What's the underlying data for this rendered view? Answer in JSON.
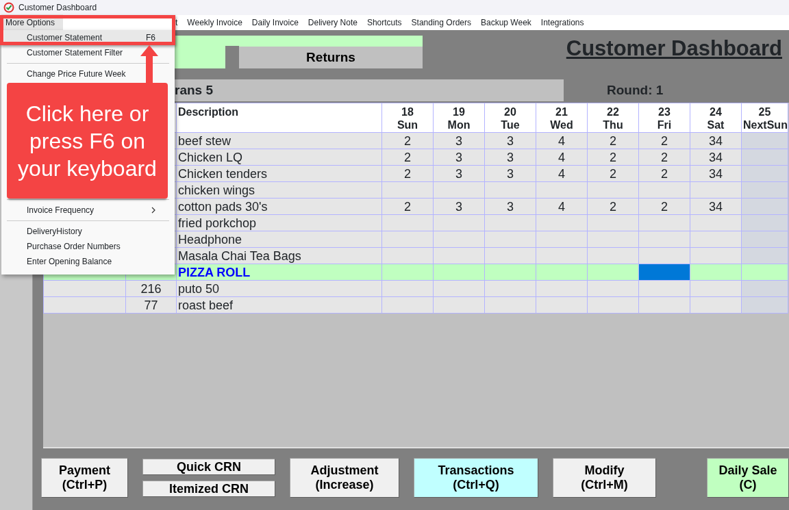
{
  "window": {
    "title": "Customer Dashboard"
  },
  "menu_bar": [
    {
      "label": "t",
      "selected": false
    },
    {
      "label": "Weekly Invoice",
      "selected": false
    },
    {
      "label": "Daily Invoice",
      "selected": false
    },
    {
      "label": "Delivery Note",
      "selected": false
    },
    {
      "label": "Shortcuts",
      "selected": false
    },
    {
      "label": "Standing Orders",
      "selected": false
    },
    {
      "label": "Backup Week",
      "selected": false
    },
    {
      "label": "Integrations",
      "selected": false
    }
  ],
  "open_menu": {
    "label": "More Options",
    "selected": true,
    "sections": [
      [
        {
          "label": "Customer Statement",
          "shortcut": "F6",
          "selected": true,
          "submenu": false
        },
        {
          "label": "Customer Statement Filter",
          "selected": false,
          "submenu": false
        }
      ],
      [
        {
          "label": "Change Price Future Week",
          "selected": false,
          "submenu": false
        }
      ],
      [
        {
          "label": "Invoice Frequency",
          "selected": false,
          "submenu": true
        }
      ],
      [
        {
          "label": "DeliveryHistory",
          "selected": false,
          "submenu": false
        },
        {
          "label": "Purchase Order Numbers",
          "selected": false,
          "submenu": false
        },
        {
          "label": "Enter Opening Balance",
          "selected": false,
          "submenu": false
        }
      ]
    ]
  },
  "callout": {
    "text": "Click here or press F6 on your keyboard"
  },
  "tabs": [
    {
      "label": "Returns",
      "selected": false
    }
  ],
  "heading": "Customer Dashboard",
  "info_bar": {
    "text": "rans 5",
    "round": "Round: 1"
  },
  "table": {
    "columns": [
      {
        "label": "Description"
      }
    ],
    "days": [
      {
        "date": "18",
        "day": "Sun",
        "focused": false,
        "next_week": false
      },
      {
        "date": "19",
        "day": "Mon",
        "focused": false,
        "next_week": false
      },
      {
        "date": "20",
        "day": "Tue",
        "focused": false,
        "next_week": false
      },
      {
        "date": "21",
        "day": "Wed",
        "focused": false,
        "next_week": false
      },
      {
        "date": "22",
        "day": "Thu",
        "focused": false,
        "next_week": false
      },
      {
        "date": "23",
        "day": "Fri",
        "focused": true,
        "next_week": false
      },
      {
        "date": "24",
        "day": "Sat",
        "focused": false,
        "next_week": false
      },
      {
        "date": "25",
        "day": "NextSun",
        "focused": false,
        "next_week": true
      }
    ],
    "rows": [
      {
        "description": "beef stew",
        "selected": false,
        "qty": [
          "2",
          "3",
          "3",
          "4",
          "2",
          "2",
          "34"
        ]
      },
      {
        "description": "Chicken LQ",
        "selected": false,
        "qty": [
          "2",
          "3",
          "3",
          "4",
          "2",
          "2",
          "34"
        ]
      },
      {
        "description": "Chicken tenders",
        "selected": false,
        "qty": [
          "2",
          "3",
          "3",
          "4",
          "2",
          "2",
          "34"
        ]
      },
      {
        "description": "chicken wings",
        "selected": false
      },
      {
        "description": "cotton pads 30's",
        "selected": false,
        "qty": [
          "2",
          "3",
          "3",
          "4",
          "2",
          "2",
          "34"
        ]
      },
      {
        "description": "fried porkchop",
        "selected": false
      },
      {
        "description": "Headphone",
        "selected": false
      },
      {
        "description": "Masala Chai Tea Bags",
        "selected": false
      },
      {
        "description": "PIZZA ROLL",
        "selected": true
      },
      {
        "code": "216",
        "description": "puto 50",
        "selected": false
      },
      {
        "code": "77",
        "description": "roast beef",
        "selected": false
      }
    ]
  },
  "buttons": [
    {
      "kind": "single",
      "lines": [
        "Payment",
        "(Ctrl+P)"
      ],
      "color": "#f0f0f0"
    },
    {
      "kind": "stack",
      "parts": [
        "Quick CRN",
        "Itemized CRN"
      ],
      "color": "#f0f0f0"
    },
    {
      "kind": "single",
      "lines": [
        "Adjustment",
        "(Increase)"
      ],
      "color": "#f0f0f0"
    },
    {
      "kind": "single",
      "lines": [
        "Transactions",
        "(Ctrl+Q)"
      ],
      "color": "#c0ffff"
    },
    {
      "kind": "single",
      "lines": [
        "Modify",
        "(Ctrl+M)"
      ],
      "color": "#f0f0f0"
    },
    {
      "kind": "single",
      "lines": [
        "Daily Sale",
        "(C)"
      ],
      "color": "#c0ffc0"
    }
  ]
}
